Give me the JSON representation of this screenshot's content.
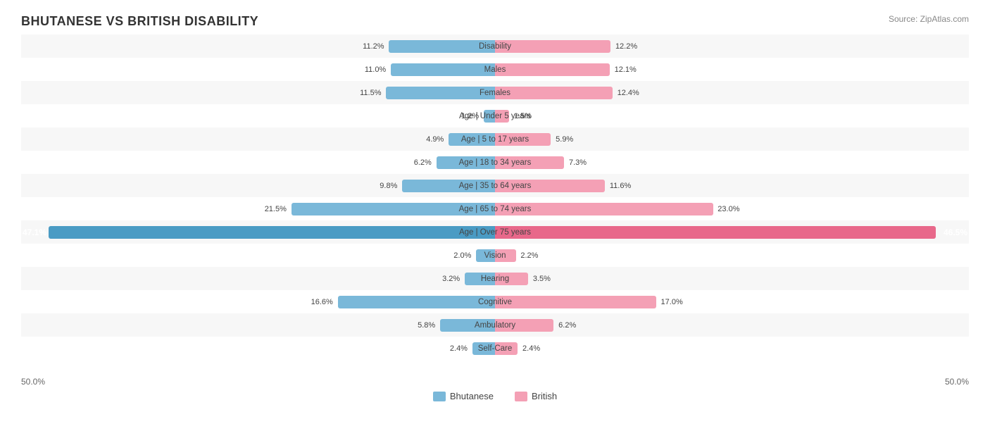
{
  "title": "BHUTANESE VS BRITISH DISABILITY",
  "source": "Source: ZipAtlas.com",
  "axis": {
    "left": "50.0%",
    "right": "50.0%"
  },
  "legend": {
    "bhutanese": "Bhutanese",
    "british": "British"
  },
  "rows": [
    {
      "label": "Disability",
      "left_val": "11.2%",
      "right_val": "12.2%",
      "left_pct": 11.2,
      "right_pct": 12.2,
      "accent": false
    },
    {
      "label": "Males",
      "left_val": "11.0%",
      "right_val": "12.1%",
      "left_pct": 11.0,
      "right_pct": 12.1,
      "accent": false
    },
    {
      "label": "Females",
      "left_val": "11.5%",
      "right_val": "12.4%",
      "left_pct": 11.5,
      "right_pct": 12.4,
      "accent": false
    },
    {
      "label": "Age | Under 5 years",
      "left_val": "1.2%",
      "right_val": "1.5%",
      "left_pct": 1.2,
      "right_pct": 1.5,
      "accent": false
    },
    {
      "label": "Age | 5 to 17 years",
      "left_val": "4.9%",
      "right_val": "5.9%",
      "left_pct": 4.9,
      "right_pct": 5.9,
      "accent": false
    },
    {
      "label": "Age | 18 to 34 years",
      "left_val": "6.2%",
      "right_val": "7.3%",
      "left_pct": 6.2,
      "right_pct": 7.3,
      "accent": false
    },
    {
      "label": "Age | 35 to 64 years",
      "left_val": "9.8%",
      "right_val": "11.6%",
      "left_pct": 9.8,
      "right_pct": 11.6,
      "accent": false
    },
    {
      "label": "Age | 65 to 74 years",
      "left_val": "21.5%",
      "right_val": "23.0%",
      "left_pct": 21.5,
      "right_pct": 23.0,
      "accent": false
    },
    {
      "label": "Age | Over 75 years",
      "left_val": "47.1%",
      "right_val": "46.5%",
      "left_pct": 47.1,
      "right_pct": 46.5,
      "accent": true
    },
    {
      "label": "Vision",
      "left_val": "2.0%",
      "right_val": "2.2%",
      "left_pct": 2.0,
      "right_pct": 2.2,
      "accent": false
    },
    {
      "label": "Hearing",
      "left_val": "3.2%",
      "right_val": "3.5%",
      "left_pct": 3.2,
      "right_pct": 3.5,
      "accent": false
    },
    {
      "label": "Cognitive",
      "left_val": "16.6%",
      "right_val": "17.0%",
      "left_pct": 16.6,
      "right_pct": 17.0,
      "accent": false
    },
    {
      "label": "Ambulatory",
      "left_val": "5.8%",
      "right_val": "6.2%",
      "left_pct": 5.8,
      "right_pct": 6.2,
      "accent": false
    },
    {
      "label": "Self-Care",
      "left_val": "2.4%",
      "right_val": "2.4%",
      "left_pct": 2.4,
      "right_pct": 2.4,
      "accent": false
    }
  ]
}
